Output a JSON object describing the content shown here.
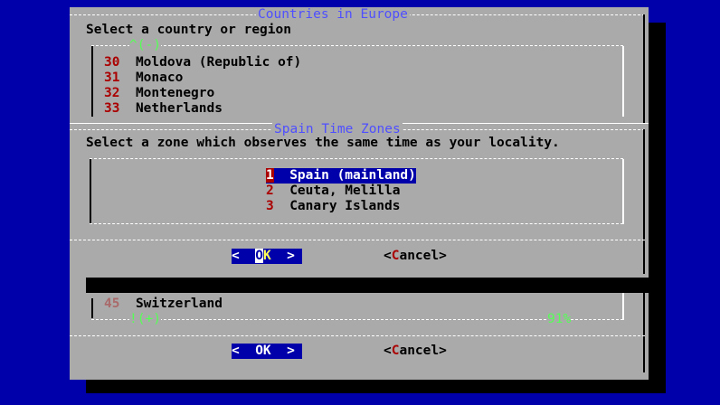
{
  "countries_dialog": {
    "title": "Countries in Europe",
    "prompt": "Select a country or region",
    "scroll_up": "^(-)",
    "scroll_down": "!(+)",
    "percent": "91%",
    "items": [
      {
        "num": "30",
        "label": "Moldova (Republic of)"
      },
      {
        "num": "31",
        "label": "Monaco"
      },
      {
        "num": "32",
        "label": "Montenegro"
      },
      {
        "num": "33",
        "label": "Netherlands"
      },
      {
        "num": "45",
        "label": "Switzerland"
      }
    ],
    "ok_label": "OK",
    "cancel_label": "Cancel"
  },
  "zones_dialog": {
    "title": "Spain Time Zones",
    "prompt": "Select a zone which observes the same time as your locality.",
    "items": [
      {
        "num": "1",
        "label": "Spain (mainland)",
        "selected": true
      },
      {
        "num": "2",
        "label": "Ceuta, Melilla",
        "selected": false
      },
      {
        "num": "3",
        "label": "Canary Islands",
        "selected": false
      }
    ],
    "ok_label": "OK",
    "cancel_label": "Cancel"
  },
  "colors": {
    "background": "#0000aa",
    "dialog": "#aaaaaa",
    "title": "#4f4fff",
    "hotkey": "#aa0000",
    "scroll_indicator": "#55ff55"
  }
}
